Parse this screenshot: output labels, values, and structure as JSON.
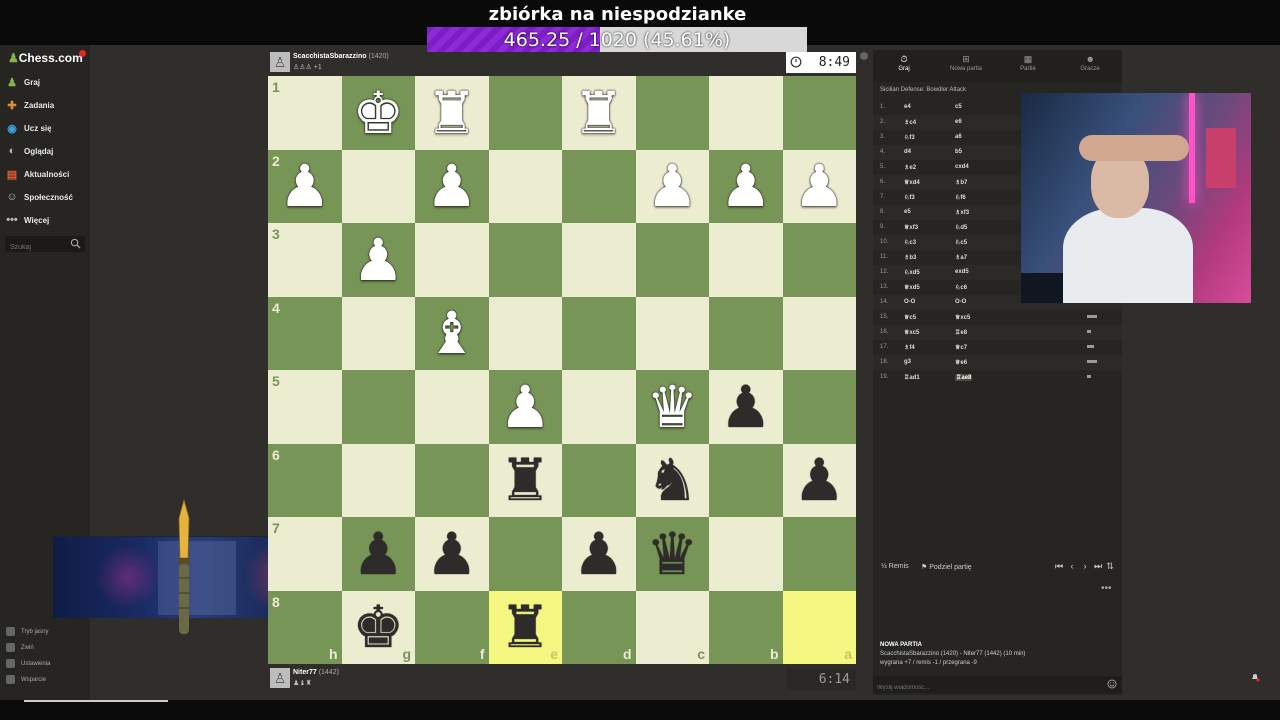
{
  "overlay": {
    "donation_title": "zbiórka na niespodzianke",
    "donation_progress_text": "465.25 / 1020 (45.61%)",
    "donation_progress": 0.4561
  },
  "sidebar": {
    "logo": "Chess.com",
    "items": [
      {
        "label": "Graj",
        "icon": "pawn-icon",
        "color": "#81b64c"
      },
      {
        "label": "Zadania",
        "icon": "puzzle-icon",
        "color": "#e58f2a"
      },
      {
        "label": "Ucz się",
        "icon": "learn-icon",
        "color": "#3aa1d6"
      },
      {
        "label": "Oglądaj",
        "icon": "watch-icon",
        "color": "#bbbbbb"
      },
      {
        "label": "Aktualności",
        "icon": "news-icon",
        "color": "#e25b38"
      },
      {
        "label": "Społeczność",
        "icon": "community-icon",
        "color": "#bbbbbb"
      },
      {
        "label": "Więcej",
        "icon": "more-icon",
        "color": "#bbbbbb"
      }
    ],
    "search_placeholder": "Szukaj",
    "bottom_items": [
      "Tryb jasny",
      "Zwiń",
      "Ustawienia",
      "Wsparcie"
    ]
  },
  "top_player": {
    "name": "ScacchistaSbarazzino",
    "rating": "(1420)",
    "captured": "♙♙♙ +1",
    "clock": "8:49"
  },
  "bottom_player": {
    "name": "Niter77",
    "rating": "(1442)",
    "captured": "♟♝♜",
    "clock": "6:14"
  },
  "board": {
    "files": [
      "h",
      "g",
      "f",
      "e",
      "d",
      "c",
      "b",
      "a"
    ],
    "ranks": [
      "1",
      "2",
      "3",
      "4",
      "5",
      "6",
      "7",
      "8"
    ],
    "rows": [
      [
        "",
        "wK",
        "wR",
        "",
        "wR",
        "",
        "",
        ""
      ],
      [
        "wP",
        "",
        "wP",
        "",
        "",
        "wP",
        "wP",
        "wP"
      ],
      [
        "",
        "wP",
        "",
        "",
        "",
        "",
        "",
        ""
      ],
      [
        "",
        "",
        "wB",
        "",
        "",
        "",
        "",
        ""
      ],
      [
        "",
        "",
        "",
        "wP",
        "",
        "wQ",
        "bP",
        ""
      ],
      [
        "",
        "",
        "",
        "bR",
        "",
        "bN",
        "",
        "bP"
      ],
      [
        "",
        "bP",
        "bP",
        "",
        "bP",
        "bQ",
        "",
        ""
      ],
      [
        "",
        "bK",
        "",
        "bR",
        "",
        "",
        "",
        ""
      ]
    ],
    "highlights": [
      [
        7,
        3
      ],
      [
        7,
        7
      ]
    ],
    "colors": {
      "light": "#ebecd0",
      "dark": "#779556",
      "highlight": "#f5f682"
    }
  },
  "right_panel": {
    "tabs": [
      "Graj",
      "Nowa partia",
      "Partie",
      "Gracze"
    ],
    "opening": "Sicilian Defense: Bowdler Attack",
    "moves": [
      {
        "n": "1.",
        "w": "e4",
        "b": "c5"
      },
      {
        "n": "2.",
        "w": "♗c4",
        "b": "e6"
      },
      {
        "n": "3.",
        "w": "♘f3",
        "b": "a6"
      },
      {
        "n": "4.",
        "w": "d4",
        "b": "b5"
      },
      {
        "n": "5.",
        "w": "♗e2",
        "b": "cxd4"
      },
      {
        "n": "6.",
        "w": "♕xd4",
        "b": "♗b7"
      },
      {
        "n": "7.",
        "w": "♘f3",
        "b": "♘f6"
      },
      {
        "n": "8.",
        "w": "e5",
        "b": "♗xf3"
      },
      {
        "n": "9.",
        "w": "♕xf3",
        "b": "♘d5"
      },
      {
        "n": "10.",
        "w": "♘c3",
        "b": "♘c5"
      },
      {
        "n": "11.",
        "w": "♗b3",
        "b": "♗a7"
      },
      {
        "n": "12.",
        "w": "♘xd5",
        "b": "exd5"
      },
      {
        "n": "13.",
        "w": "♕xd5",
        "b": "♘c6"
      },
      {
        "n": "14.",
        "w": "O-O",
        "b": "O-O"
      },
      {
        "n": "15.",
        "w": "♕c5",
        "b": "♕xc5"
      },
      {
        "n": "16.",
        "w": "♕xc5",
        "b": "♖e8"
      },
      {
        "n": "17.",
        "w": "♗f4",
        "b": "♕c7"
      },
      {
        "n": "18.",
        "w": "g3",
        "b": "♕e6"
      },
      {
        "n": "19.",
        "w": "♖ad1",
        "b": "♖ae8"
      }
    ],
    "draw_label": "Remis",
    "share_label": "Podziel partię",
    "game_info_title": "NOWA PARTIA",
    "game_info_players": "ScacchistaSbarazzino (1420) - Niter77 (1442) (10 min)",
    "game_info_record": "wygrana +7 / remis -1 / przegrana -9",
    "chat_placeholder": "Wyślij wiadomość..."
  }
}
